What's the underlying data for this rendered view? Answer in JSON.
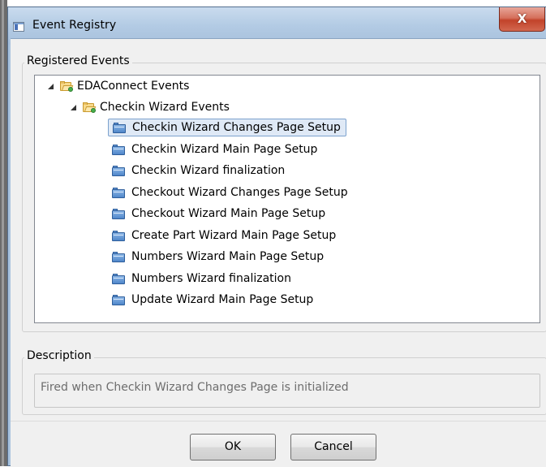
{
  "window": {
    "title": "Event Registry",
    "close_glyph": "X"
  },
  "registered_events": {
    "label": "Registered Events",
    "root": {
      "label": "EDAConnect Events"
    },
    "group": {
      "label": "Checkin Wizard Events"
    },
    "items": [
      {
        "label": "Checkin Wizard Changes Page Setup",
        "selected": true
      },
      {
        "label": "Checkin Wizard Main Page Setup"
      },
      {
        "label": "Checkin Wizard finalization"
      },
      {
        "label": "Checkout Wizard Changes Page Setup"
      },
      {
        "label": "Checkout Wizard Main Page Setup"
      },
      {
        "label": "Create Part Wizard Main Page Setup"
      },
      {
        "label": "Numbers Wizard Main Page Setup"
      },
      {
        "label": "Numbers Wizard finalization"
      },
      {
        "label": "Update Wizard Main Page Setup"
      }
    ]
  },
  "description": {
    "label": "Description",
    "text": "Fired when Checkin Wizard Changes Page is initialized"
  },
  "buttons": {
    "ok": "OK",
    "cancel": "Cancel"
  },
  "icons": {
    "app": "window-icon",
    "expand": "expanded-triangle-icon",
    "group_folder": "open-folder-icon",
    "event": "event-folder-icon"
  },
  "colors": {
    "title_bar": "#b3cbe4",
    "close_button": "#c2432a",
    "selection_fill": "#dfe9f6",
    "selection_border": "#7da2ce",
    "event_icon": "#4f86c9"
  }
}
